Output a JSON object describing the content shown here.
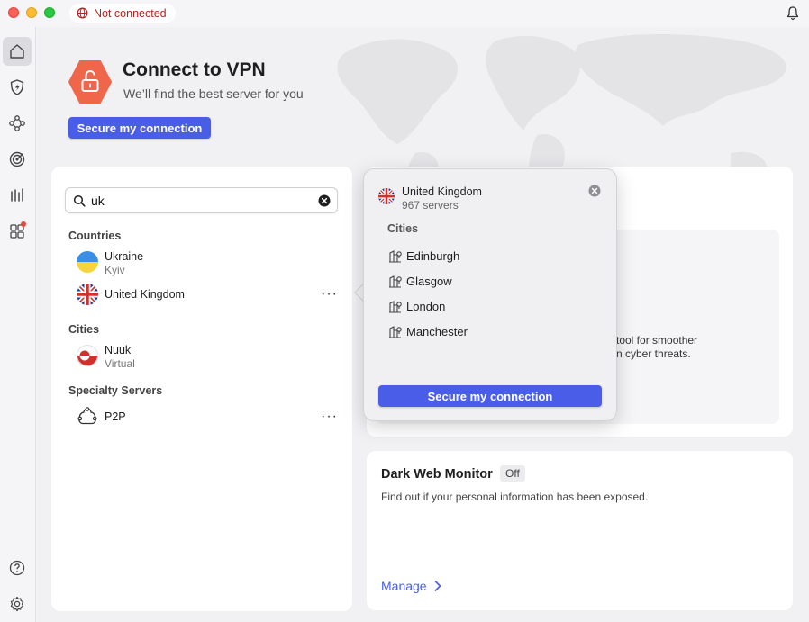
{
  "titlebar": {
    "status": "Not connected"
  },
  "hero": {
    "title": "Connect to VPN",
    "subtitle": "We’ll find the best server for you",
    "button": "Secure my connection"
  },
  "search": {
    "value": "uk"
  },
  "sections": {
    "countries": "Countries",
    "cities": "Cities",
    "specialty": "Specialty Servers"
  },
  "countries": [
    {
      "name": "Ukraine",
      "sub": "Kyiv"
    },
    {
      "name": "United Kingdom"
    }
  ],
  "cities": [
    {
      "name": "Nuuk",
      "sub": "Virtual"
    }
  ],
  "specialty": [
    {
      "name": "P2P"
    }
  ],
  "more_label": "···",
  "popover": {
    "title": "United Kingdom",
    "subtitle": "967 servers",
    "cities_label": "Cities",
    "cities": [
      "Edinburgh",
      "Glasgow",
      "London",
      "Manchester"
    ],
    "button": "Secure my connection"
  },
  "card_partial": {
    "line1": "tool for smoother",
    "line2": "n cyber threats."
  },
  "dark_web": {
    "title": "Dark Web Monitor",
    "badge": "Off",
    "description": "Find out if your personal information has been exposed.",
    "manage": "Manage"
  },
  "colors": {
    "accent": "#4a5de8",
    "alert": "#b3261e",
    "hero_icon": "#f0664a"
  }
}
